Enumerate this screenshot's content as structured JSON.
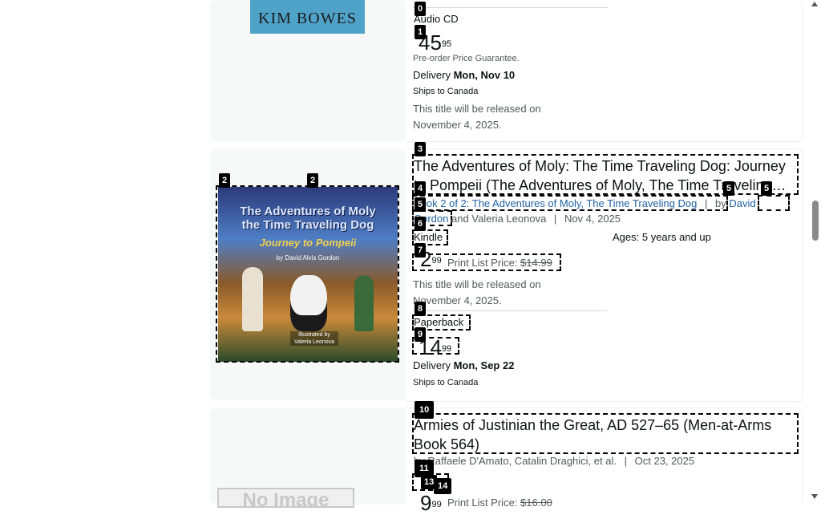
{
  "items": [
    {
      "cover_text": "KIM BOWES",
      "format": "Audio CD",
      "price_whole": "45",
      "price_frac": "95",
      "preorder": "Pre-order Price Guarantee.",
      "delivery_label": "Delivery",
      "delivery_date": "Mon, Nov 10",
      "ships": "Ships to Canada",
      "release_note": "This title will be released on November 4, 2025."
    },
    {
      "title": "The Adventures of Moly: The Time Traveling Dog: Journey to Pompeii (The Adventures of Moly, The Time Traveling…",
      "series_link": "Book 2 of 2: The Adventures of Moly, The Time Traveling Dog",
      "by": "by",
      "author1": "David Gordon",
      "and_author2": "and Valeria Leonova",
      "date": "Nov 4, 2025",
      "ages": "Ages: 5 years and up",
      "cover_title": "The Adventures of Moly the Time Traveling Dog",
      "cover_subtitle": "Journey to Pompeii",
      "cover_author": "by David Alvis Gordon",
      "cover_illus": "Illustrated by Valeria Leonova",
      "kindle_format": "Kindle",
      "kindle_whole": "2",
      "kindle_frac": "99",
      "print_list_label": "Print List Price:",
      "print_list_price": "$14.99",
      "kindle_release": "This title will be released on November 4, 2025.",
      "paper_format": "Paperback",
      "paper_whole": "14",
      "paper_frac": "99",
      "delivery_label": "Delivery",
      "delivery_date": "Mon, Sep 22",
      "ships": "Ships to Canada"
    },
    {
      "title": "Armies of Justinian the Great, AD 527–65 (Men-at-Arms Book 564)",
      "authors": "by Raffaele D'Amato, Catalin Draghici, et al.",
      "date": "Oct 23, 2025",
      "price_whole": "9",
      "price_frac": "99",
      "print_list_label": "Print List Price:",
      "print_list_price": "$16.00",
      "cover_text": "No Image"
    }
  ],
  "tags": [
    "0",
    "1",
    "2",
    "2",
    "3",
    "4",
    "5",
    "5",
    "6",
    "7",
    "8",
    "9",
    "10",
    "11",
    "13",
    "14"
  ],
  "sep": "|"
}
